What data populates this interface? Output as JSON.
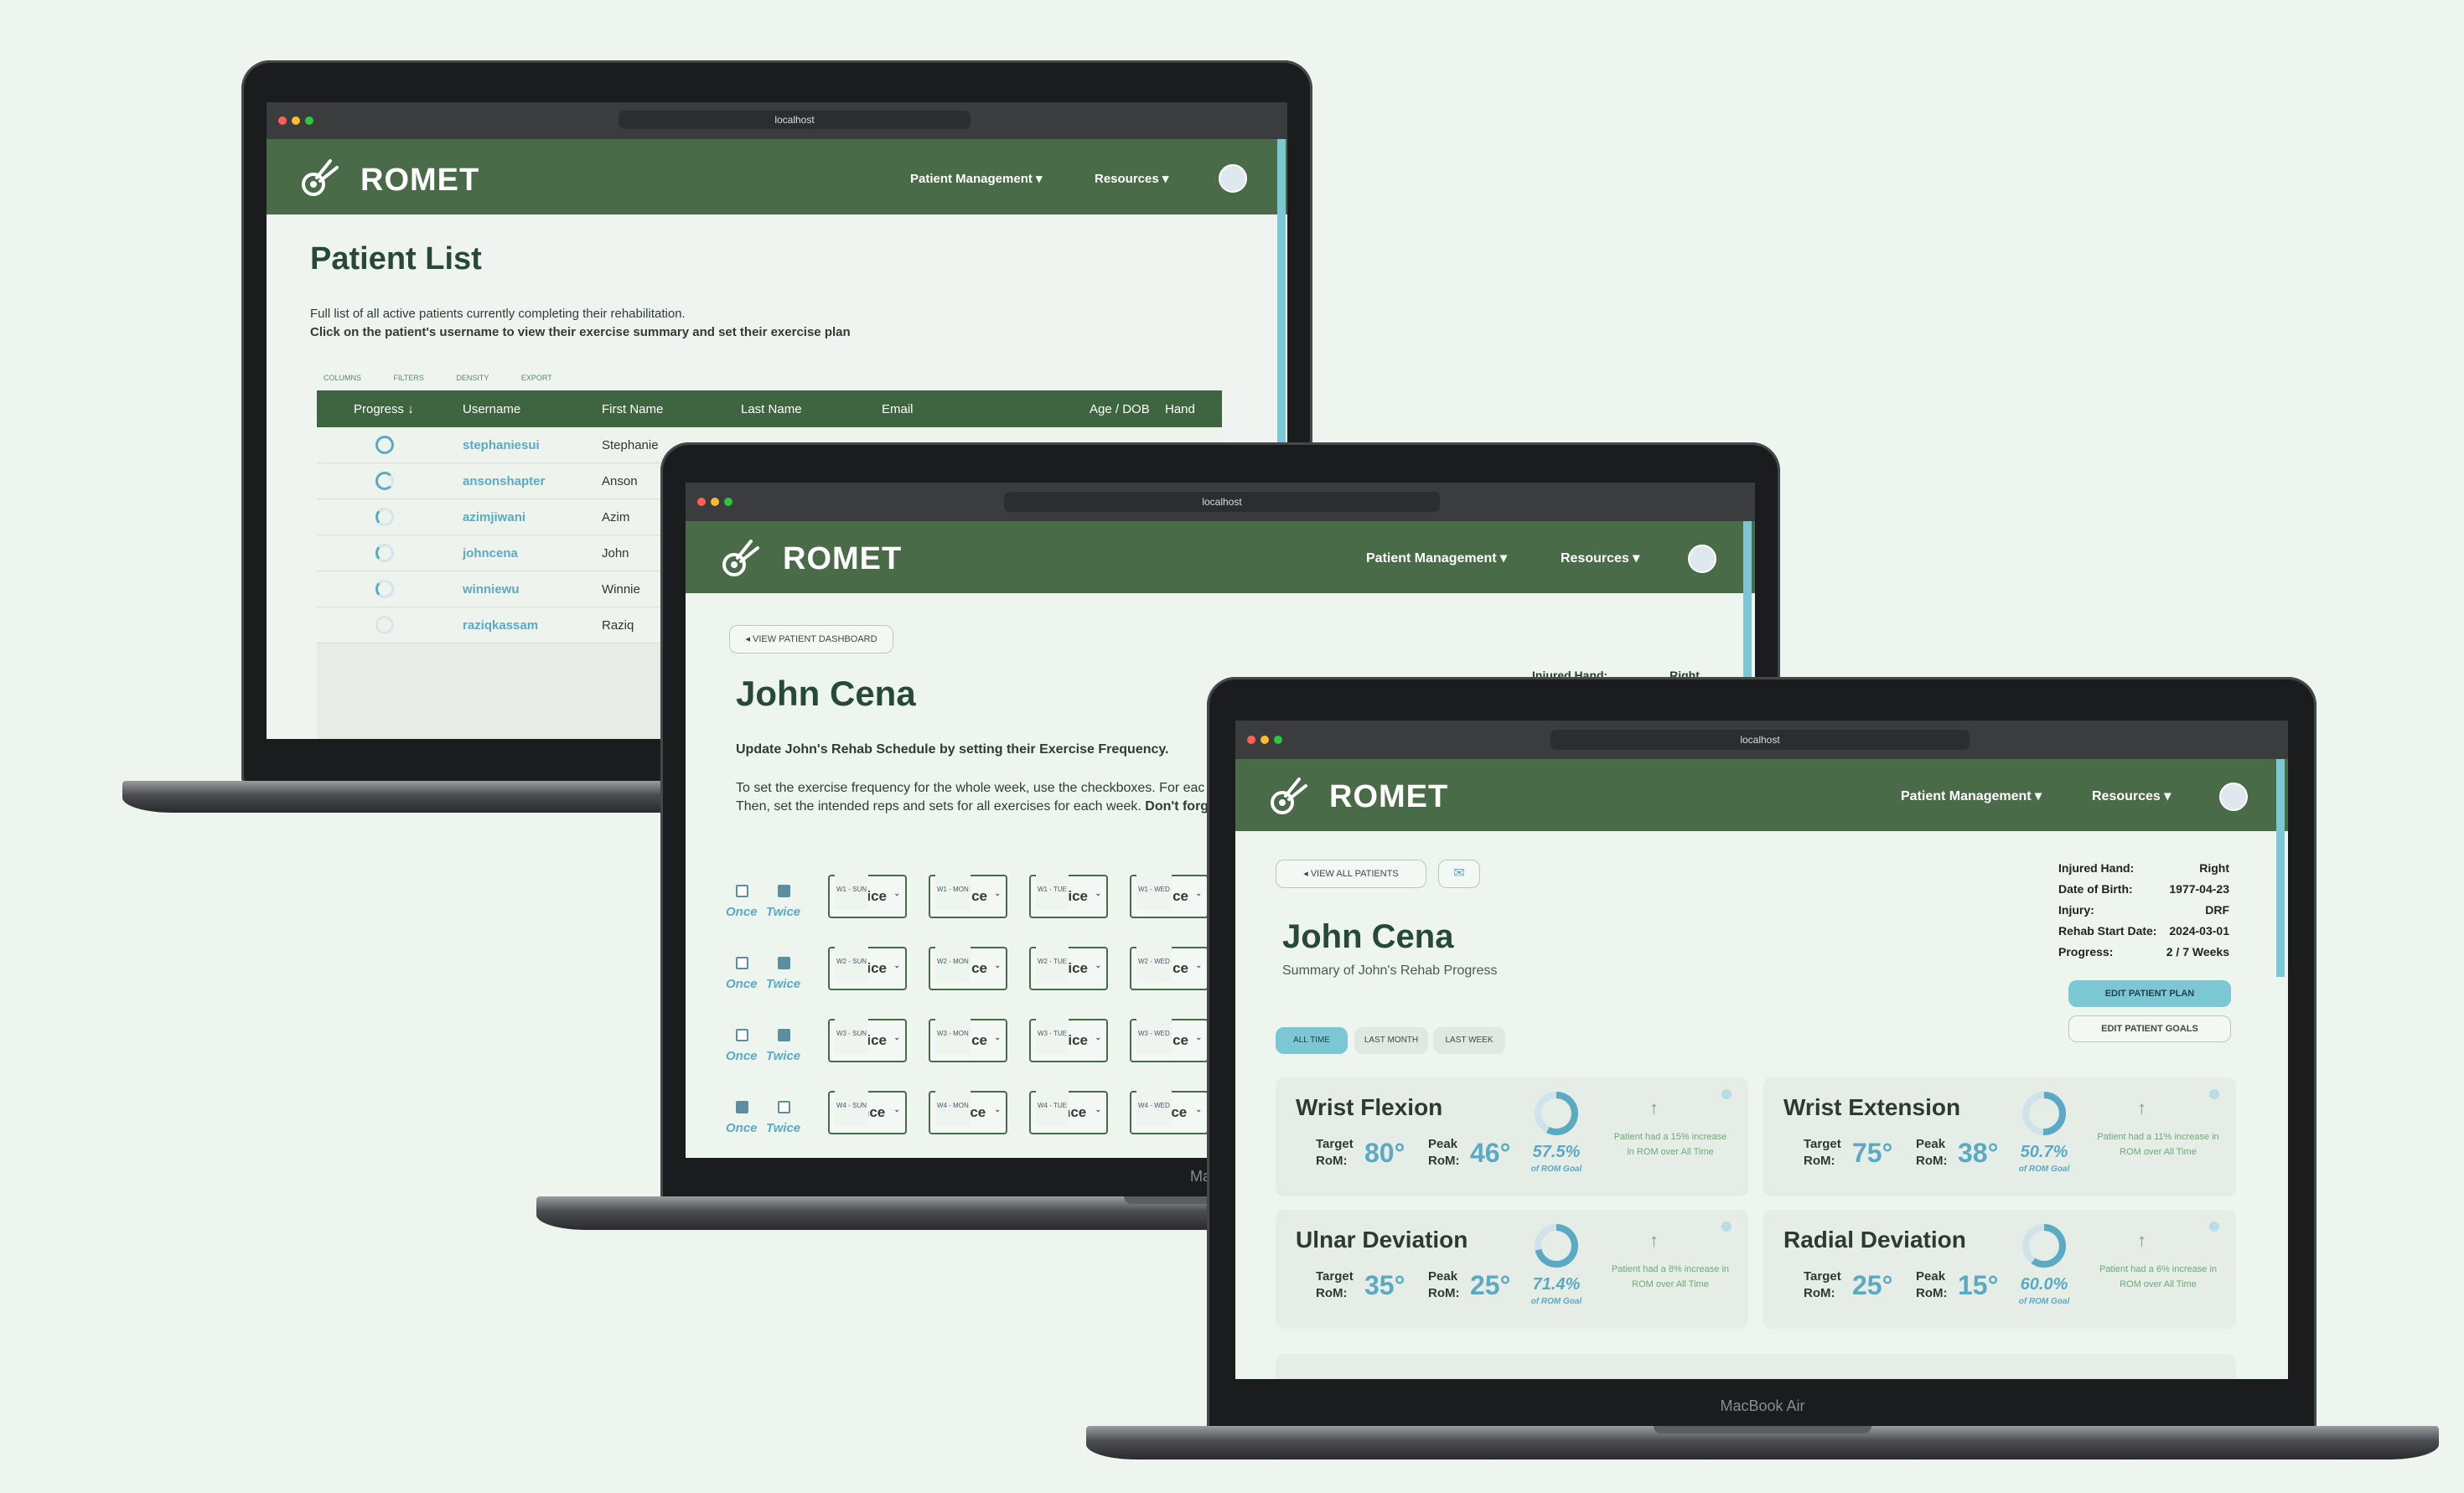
{
  "browser": {
    "url": "localhost"
  },
  "app": {
    "brand": "ROMET",
    "nav": {
      "patient_management": "Patient Management",
      "resources": "Resources"
    }
  },
  "patient_list": {
    "title": "Patient List",
    "desc_line1": "Full list of all active patients currently completing their rehabilitation.",
    "desc_line2": "Click on the patient's username to view their exercise summary and set their exercise plan",
    "toolbar": [
      "COLUMNS",
      "FILTERS",
      "DENSITY",
      "EXPORT"
    ],
    "columns": [
      "Progress",
      "Username",
      "First Name",
      "Last Name",
      "Email",
      "Age / DOB",
      "Hand"
    ],
    "rows": [
      {
        "username": "stephaniesui",
        "first_name": "Stephanie"
      },
      {
        "username": "ansonshapter",
        "first_name": "Anson"
      },
      {
        "username": "azimjiwani",
        "first_name": "Azim"
      },
      {
        "username": "johncena",
        "first_name": "John"
      },
      {
        "username": "winniewu",
        "first_name": "Winnie"
      },
      {
        "username": "raziqkassam",
        "first_name": "Raziq"
      }
    ]
  },
  "plan": {
    "back_button": "VIEW PATIENT DASHBOARD",
    "patient_name": "John Cena",
    "heading": "Update John's Rehab Schedule by setting their Exercise Frequency.",
    "info_line1": "To set the exercise frequency for the whole week, use the checkboxes. For eac",
    "info_line2": "Then, set the intended reps and sets for all exercises for each week.",
    "info_line2_bold": "Don't forg",
    "top_right_label": "Injured Hand:",
    "top_right_value": "Right",
    "once": "Once",
    "twice": "Twice",
    "weeks": [
      {
        "once": false,
        "twice": true,
        "cells": [
          {
            "label": "W1 - SUN",
            "value": "Twice"
          },
          {
            "label": "W1 - MON",
            "value": "Twice"
          },
          {
            "label": "W1 - TUE",
            "value": "Twice"
          },
          {
            "label": "W1 - WED",
            "value": "Twice"
          }
        ]
      },
      {
        "once": false,
        "twice": true,
        "cells": [
          {
            "label": "W2 - SUN",
            "value": "Twice"
          },
          {
            "label": "W2 - MON",
            "value": "Twice"
          },
          {
            "label": "W2 - TUE",
            "value": "Twice"
          },
          {
            "label": "W2 - WED",
            "value": "Twice"
          }
        ]
      },
      {
        "once": false,
        "twice": true,
        "cells": [
          {
            "label": "W3 - SUN",
            "value": "Twice"
          },
          {
            "label": "W3 - MON",
            "value": "Twice"
          },
          {
            "label": "W3 - TUE",
            "value": "Twice"
          },
          {
            "label": "W3 - WED",
            "value": "Twice"
          }
        ]
      },
      {
        "once": true,
        "twice": false,
        "cells": [
          {
            "label": "W4 - SUN",
            "value": "Once"
          },
          {
            "label": "W4 - MON",
            "value": "Once"
          },
          {
            "label": "W4 - TUE",
            "value": "Once"
          },
          {
            "label": "W4 - WED",
            "value": "Once"
          }
        ]
      }
    ],
    "device_label": "MacB"
  },
  "dashboard": {
    "back_button": "VIEW ALL PATIENTS",
    "patient_name": "John Cena",
    "subtitle": "Summary of John's Rehab Progress",
    "info": [
      {
        "label": "Injured Hand:",
        "value": "Right"
      },
      {
        "label": "Date of Birth:",
        "value": "1977-04-23"
      },
      {
        "label": "Injury:",
        "value": "DRF"
      },
      {
        "label": "Rehab Start Date:",
        "value": "2024-03-01"
      },
      {
        "label": "Progress:",
        "value": "2 / 7 Weeks"
      }
    ],
    "edit_plan": "EDIT PATIENT PLAN",
    "edit_goals": "EDIT PATIENT GOALS",
    "filters": [
      "ALL TIME",
      "LAST MONTH",
      "LAST WEEK"
    ],
    "target_label": "Target\nRoM:",
    "peak_label": "Peak\nRoM:",
    "goal_label": "of ROM Goal",
    "cards": [
      {
        "title": "Wrist Flexion",
        "target": "80°",
        "peak": "46°",
        "pct": "57.5%",
        "pct_value": 57.5,
        "note": "Patient had a 15% increase in ROM over All Time"
      },
      {
        "title": "Wrist Extension",
        "target": "75°",
        "peak": "38°",
        "pct": "50.7%",
        "pct_value": 50.7,
        "note": "Patient had a 11% increase in ROM over All Time"
      },
      {
        "title": "Ulnar Deviation",
        "target": "35°",
        "peak": "25°",
        "pct": "71.4%",
        "pct_value": 71.4,
        "note": "Patient had a 8% increase in ROM over All Time"
      },
      {
        "title": "Radial Deviation",
        "target": "25°",
        "peak": "15°",
        "pct": "60.0%",
        "pct_value": 60.0,
        "note": "Patient had a 6% increase in ROM over All Time"
      }
    ],
    "device_label": "MacBook Air"
  },
  "colors": {
    "brand_green": "#4a6b47",
    "accent_teal": "#5aaac3",
    "page_bg": "#eef5ee"
  }
}
